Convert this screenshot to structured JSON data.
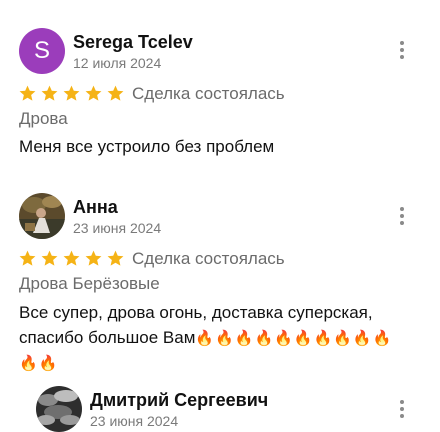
{
  "colors": {
    "star": "#f5b316",
    "avatar_s": "#9b3dbb",
    "muted_text": "#7a7a7a"
  },
  "reviews": [
    {
      "avatar_letter": "S",
      "name": "Serega Tcelev",
      "date": "12 июля 2024",
      "rating": 5,
      "deal_status": "Сделка состоялась",
      "product": "Дрова",
      "text": "Меня все устроило без проблем",
      "more_icon": "more-vertical-icon"
    },
    {
      "avatar_letter": "",
      "name": "Анна",
      "date": "23 июня 2024",
      "rating": 5,
      "deal_status": "Сделка состоялась",
      "product": "Дрова Берёзовые",
      "text_line1": "Все супер, дрова огонь, доставка суперская,",
      "text_line2": "спасибо большое Вам",
      "fires_inline": "🔥🔥🔥🔥🔥🔥🔥🔥🔥🔥",
      "fires_line3": "🔥🔥",
      "more_icon": "more-vertical-icon"
    },
    {
      "avatar_letter": "",
      "name": "Дмитрий Сергеевич",
      "date": "23 июня 2024",
      "more_icon": "more-vertical-icon"
    }
  ]
}
